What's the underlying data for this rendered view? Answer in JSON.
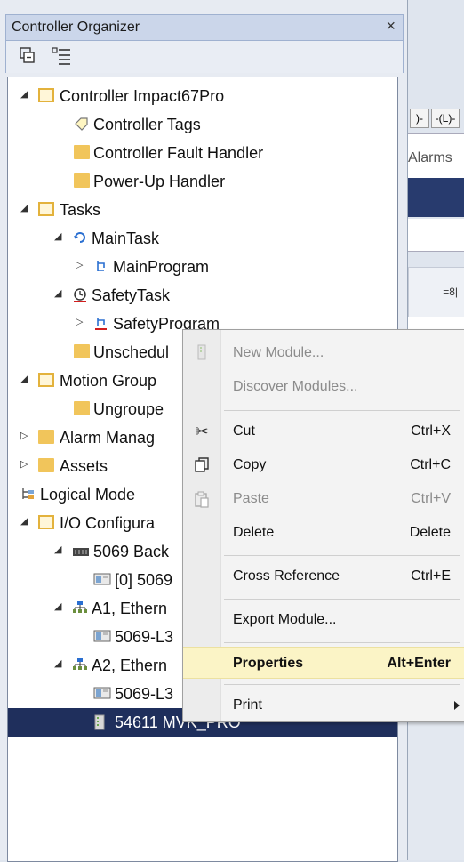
{
  "panel": {
    "title": "Controller Organizer",
    "close_glyph": "×"
  },
  "toolbar": {
    "buttons": [
      "collapse-all-icon",
      "expand-all-icon"
    ]
  },
  "tree": [
    {
      "label": "Controller Impact67Pro",
      "icon": "folder-open-icon",
      "expander": "◢"
    },
    {
      "label": "Controller Tags",
      "icon": "tag-icon"
    },
    {
      "label": "Controller Fault Handler",
      "icon": "folder-icon"
    },
    {
      "label": "Power-Up Handler",
      "icon": "folder-icon"
    },
    {
      "label": "Tasks",
      "icon": "folder-open-icon",
      "expander": "◢"
    },
    {
      "label": "MainTask",
      "icon": "continuous-task-icon",
      "expander": "◢"
    },
    {
      "label": "MainProgram",
      "icon": "program-icon",
      "expander": "▷"
    },
    {
      "label": "SafetyTask",
      "icon": "safety-task-icon",
      "expander": "◢"
    },
    {
      "label": "SafetyProgram",
      "icon": "safety-program-icon",
      "expander": "▷"
    },
    {
      "label": "Unschedul",
      "icon": "folder-icon"
    },
    {
      "label": "Motion Group",
      "icon": "folder-open-icon",
      "expander": "◢"
    },
    {
      "label": "Ungroupe",
      "icon": "folder-icon"
    },
    {
      "label": "Alarm Manag",
      "icon": "folder-icon",
      "expander": "▷"
    },
    {
      "label": "Assets",
      "icon": "folder-icon",
      "expander": "▷"
    },
    {
      "label": "Logical Mode",
      "icon": "logical-model-icon"
    },
    {
      "label": "I/O Configura",
      "icon": "folder-open-icon",
      "expander": "◢"
    },
    {
      "label": "5069 Back",
      "icon": "backplane-icon",
      "expander": "◢"
    },
    {
      "label": "[0] 5069",
      "icon": "module-icon"
    },
    {
      "label": "A1, Ethern",
      "icon": "network-icon",
      "expander": "◢"
    },
    {
      "label": "5069-L3",
      "icon": "module-icon"
    },
    {
      "label": "A2, Ethern",
      "icon": "network-icon",
      "expander": "◢"
    },
    {
      "label": "5069-L3",
      "icon": "module-icon"
    },
    {
      "label": "54611 MVK_PRO",
      "icon": "device-icon",
      "selected": true
    }
  ],
  "context_menu": {
    "items": [
      {
        "label": "New Module...",
        "shortcut": "",
        "disabled": true,
        "icon": "new-module-icon"
      },
      {
        "label": "Discover Modules...",
        "shortcut": "",
        "disabled": true
      },
      {
        "label": "Cut",
        "shortcut": "Ctrl+X",
        "icon": "scissors-icon"
      },
      {
        "label": "Copy",
        "shortcut": "Ctrl+C",
        "icon": "copy-icon"
      },
      {
        "label": "Paste",
        "shortcut": "Ctrl+V",
        "disabled": true,
        "icon": "paste-icon"
      },
      {
        "label": "Delete",
        "shortcut": "Delete"
      },
      {
        "label": "Cross Reference",
        "shortcut": "Ctrl+E"
      },
      {
        "label": "Export Module...",
        "shortcut": ""
      },
      {
        "label": "Properties",
        "shortcut": "Alt+Enter",
        "highlighted": true
      },
      {
        "label": "Print",
        "shortcut": "",
        "submenu": true
      }
    ]
  },
  "background": {
    "alarms_label": "Alarms",
    "ladder_label_1": ")-",
    "ladder_label_2": "-(L)-",
    "tool_glyph": "=8|"
  }
}
